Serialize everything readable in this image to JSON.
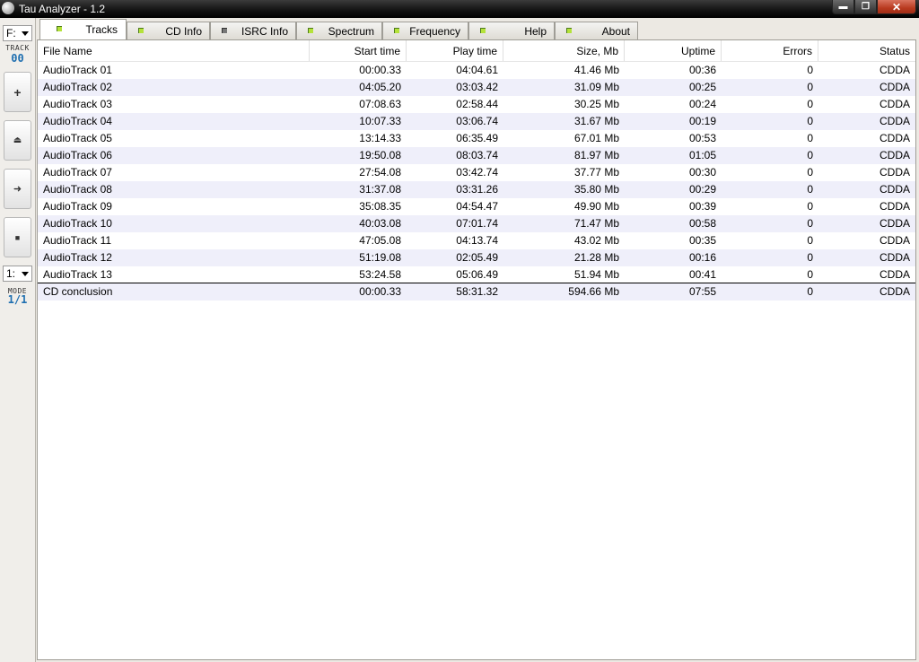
{
  "window": {
    "title": "Tau Analyzer - 1.2"
  },
  "toolbar": {
    "drive": "F:",
    "track_label": "TRACK",
    "track_value": "00",
    "mode_select": "1:",
    "mode_label": "MODE",
    "mode_value": "1/1"
  },
  "tabs": [
    {
      "label": "Tracks"
    },
    {
      "label": "CD Info"
    },
    {
      "label": "ISRC Info"
    },
    {
      "label": "Spectrum"
    },
    {
      "label": "Frequency"
    },
    {
      "label": "Help"
    },
    {
      "label": "About"
    }
  ],
  "table": {
    "columns": [
      "File Name",
      "Start time",
      "Play time",
      "Size, Mb",
      "Uptime",
      "Errors",
      "Status"
    ],
    "rows": [
      [
        "AudioTrack 01",
        "00:00.33",
        "04:04.61",
        "41.46 Mb",
        "00:36",
        "0",
        "CDDA"
      ],
      [
        "AudioTrack 02",
        "04:05.20",
        "03:03.42",
        "31.09 Mb",
        "00:25",
        "0",
        "CDDA"
      ],
      [
        "AudioTrack 03",
        "07:08.63",
        "02:58.44",
        "30.25 Mb",
        "00:24",
        "0",
        "CDDA"
      ],
      [
        "AudioTrack 04",
        "10:07.33",
        "03:06.74",
        "31.67 Mb",
        "00:19",
        "0",
        "CDDA"
      ],
      [
        "AudioTrack 05",
        "13:14.33",
        "06:35.49",
        "67.01 Mb",
        "00:53",
        "0",
        "CDDA"
      ],
      [
        "AudioTrack 06",
        "19:50.08",
        "08:03.74",
        "81.97 Mb",
        "01:05",
        "0",
        "CDDA"
      ],
      [
        "AudioTrack 07",
        "27:54.08",
        "03:42.74",
        "37.77 Mb",
        "00:30",
        "0",
        "CDDA"
      ],
      [
        "AudioTrack 08",
        "31:37.08",
        "03:31.26",
        "35.80 Mb",
        "00:29",
        "0",
        "CDDA"
      ],
      [
        "AudioTrack 09",
        "35:08.35",
        "04:54.47",
        "49.90 Mb",
        "00:39",
        "0",
        "CDDA"
      ],
      [
        "AudioTrack 10",
        "40:03.08",
        "07:01.74",
        "71.47 Mb",
        "00:58",
        "0",
        "CDDA"
      ],
      [
        "AudioTrack 11",
        "47:05.08",
        "04:13.74",
        "43.02 Mb",
        "00:35",
        "0",
        "CDDA"
      ],
      [
        "AudioTrack 12",
        "51:19.08",
        "02:05.49",
        "21.28 Mb",
        "00:16",
        "0",
        "CDDA"
      ],
      [
        "AudioTrack 13",
        "53:24.58",
        "05:06.49",
        "51.94 Mb",
        "00:41",
        "0",
        "CDDA"
      ]
    ],
    "total": [
      "CD conclusion",
      "00:00.33",
      "58:31.32",
      "594.66 Mb",
      "07:55",
      "0",
      "CDDA"
    ]
  }
}
